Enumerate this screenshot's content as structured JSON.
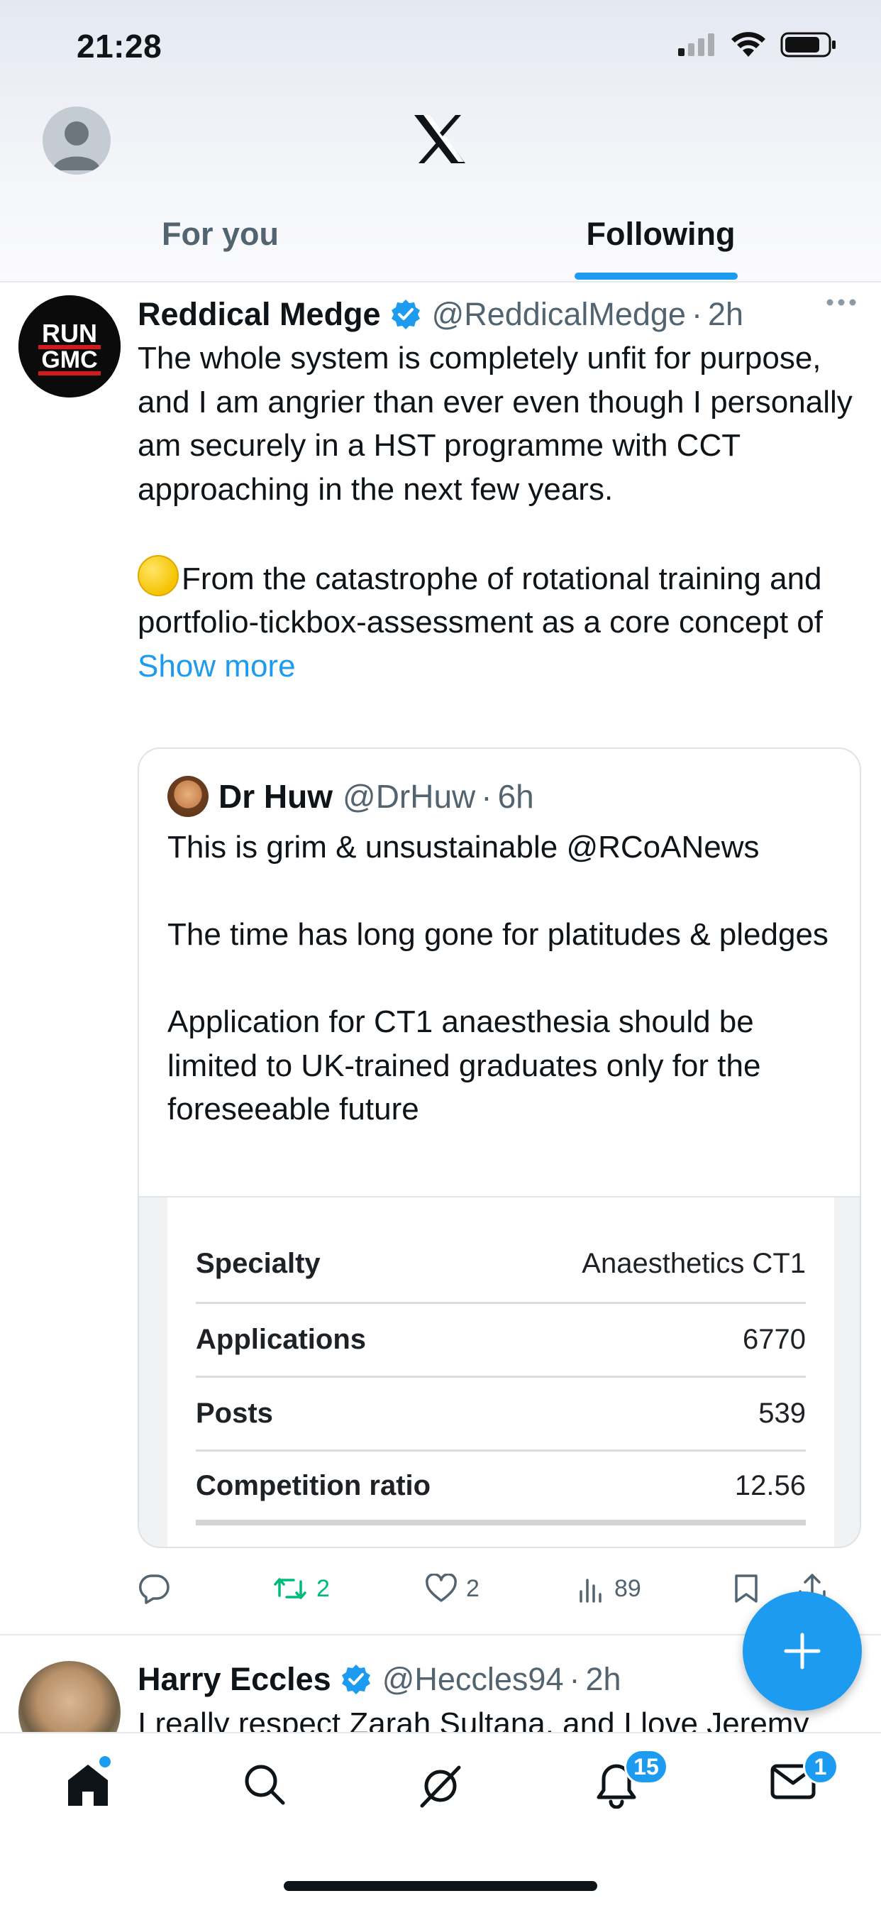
{
  "status": {
    "time": "21:28"
  },
  "header": {
    "tabs": [
      {
        "label": "For you",
        "active": false
      },
      {
        "label": "Following",
        "active": true
      }
    ]
  },
  "tweet": {
    "author_avatar_text": "RUN GMC",
    "name": "Reddical Medge",
    "handle": "@ReddicalMedge",
    "separator": "·",
    "time": "2h",
    "paragraph1": "The whole system is completely unfit for purpose, and I am angrier than ever even though I personally am securely in a HST programme with CCT approaching in the next few years.",
    "paragraph2": "From the catastrophe of rotational training and portfolio-tickbox-assessment as a core concept of",
    "show_more": "Show more",
    "quote": {
      "name": "Dr Huw",
      "handle": "@DrHuw",
      "separator": "·",
      "time": "6h",
      "line1": "This is grim & unsustainable @RCoANews",
      "line2": "The time has long gone for platitudes & pledges",
      "line3": "Application for CT1 anaesthesia should be limited to UK-trained graduates only for the foreseeable future",
      "table": [
        {
          "key": "Specialty",
          "value": "Anaesthetics CT1"
        },
        {
          "key": "Applications",
          "value": "6770"
        },
        {
          "key": "Posts",
          "value": "539"
        },
        {
          "key": "Competition ratio",
          "value": "12.56"
        }
      ]
    },
    "actions": {
      "replies": "",
      "retweets": "2",
      "likes": "2",
      "views": "89"
    }
  },
  "tweet2": {
    "name": "Harry Eccles",
    "handle": "@Heccles94",
    "separator": "·",
    "time": "2h",
    "text": "I really respect Zarah Sultana, and I love Jeremy"
  },
  "bottom_nav": {
    "notifications_badge": "15",
    "messages_badge": "1"
  },
  "colors": {
    "accent": "#1d9bf0",
    "retweet": "#00ba7c",
    "secondary_text": "#536471"
  }
}
